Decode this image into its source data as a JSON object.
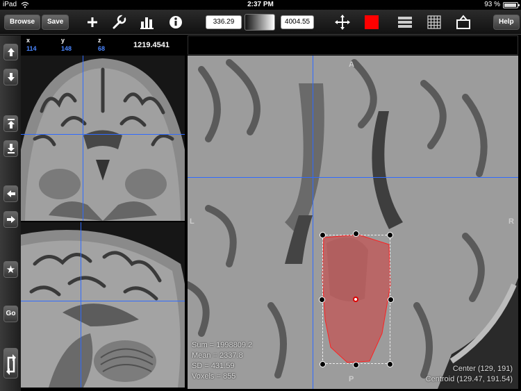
{
  "status_bar": {
    "carrier": "iPad",
    "time": "2:37 PM",
    "battery": "93 %"
  },
  "toolbar": {
    "browse_label": "Browse",
    "save_label": "Save",
    "window_min": "336.29",
    "window_max": "4004.55",
    "help_label": "Help",
    "roi_color": "#ff0000"
  },
  "sidebar": {
    "star_label": "★",
    "go_label": "Go"
  },
  "coords": {
    "x_label": "x",
    "y_label": "y",
    "z_label": "z",
    "x_value": "114",
    "y_value": "148",
    "z_value": "68",
    "intensity": "1219.4541"
  },
  "main_view": {
    "orient_top": "A",
    "orient_bottom": "P",
    "orient_left": "L",
    "orient_right": "R",
    "stats": {
      "sum": "Sum = 1998809.2",
      "mean": "Mean = 2337.8",
      "sd": "SD = 431.59",
      "voxels": "Voxels = 855"
    },
    "center": "Center (129, 191)",
    "centroid": "Centroid (129.47, 191.54)"
  },
  "colors": {
    "crosshair": "#2f6bff",
    "roi_fill": "#d23c3c",
    "accent_value": "#4a86ff"
  }
}
